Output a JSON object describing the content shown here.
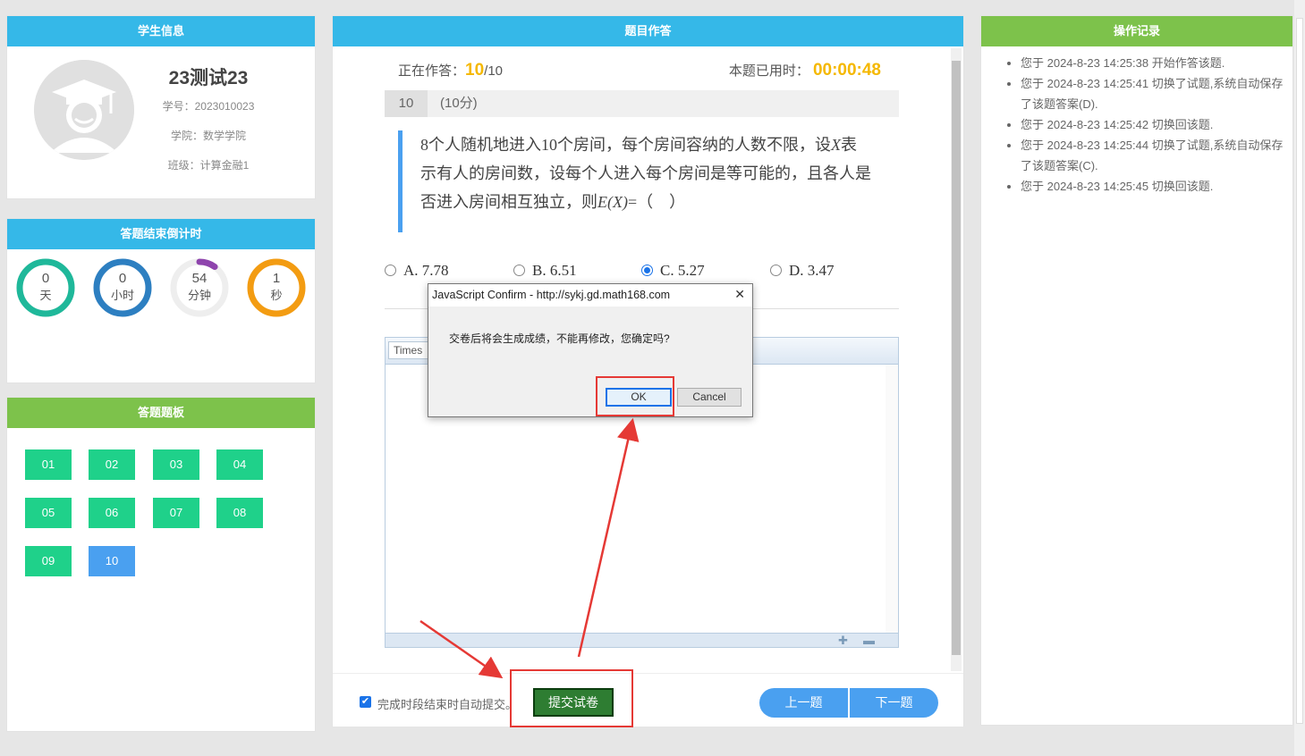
{
  "student": {
    "header": "学生信息",
    "name": "23测试23",
    "id_line": "学号：2023010023",
    "college_line": "学院：数学学院",
    "class_line": "班级：计算金融1"
  },
  "countdown": {
    "header": "答题结束倒计时",
    "items": [
      {
        "value": "0",
        "unit": "天",
        "color": "#1fb89a",
        "fraction": 1.0
      },
      {
        "value": "0",
        "unit": "小时",
        "color": "#2d7fc1",
        "fraction": 1.0
      },
      {
        "value": "54",
        "unit": "分钟",
        "color": "#8e44ad",
        "fraction": 0.1
      },
      {
        "value": "1",
        "unit": "秒",
        "color": "#f39c12",
        "fraction": 1.0
      }
    ]
  },
  "board": {
    "header": "答题题板",
    "questions": [
      "01",
      "02",
      "03",
      "04",
      "05",
      "06",
      "07",
      "08",
      "09",
      "10"
    ],
    "current": "10"
  },
  "main": {
    "header": "题目作答",
    "status_label": "正在作答：",
    "current": "10",
    "total": "/10",
    "timer_label": "本题已用时：",
    "timer": "00:00:48",
    "q_num": "10",
    "q_points": "(10分)",
    "question_html_parts": [
      "8个人随机地进入10个房间，每个房间容纳的人数不限，设",
      "X",
      "表示有人的房间数，设每个人进入每个房间是等可能的，且各人是否进入房间相互独立，则",
      "E(X)",
      "=（　）"
    ],
    "options": [
      {
        "label": "A. 7.78",
        "selected": false
      },
      {
        "label": "B. 6.51",
        "selected": false
      },
      {
        "label": "C. 5.27",
        "selected": true
      },
      {
        "label": "D. 3.47",
        "selected": false
      }
    ],
    "editor_font": "Times",
    "auto_submit_label": "完成时段结束时自动提交。",
    "submit_label": "提交试卷",
    "prev_label": "上一题",
    "next_label": "下一题"
  },
  "log": {
    "header": "操作记录",
    "entries": [
      "您于 2024-8-23  14:25:38 开始作答该题.",
      "您于 2024-8-23  14:25:41 切换了试题,系统自动保存了该题答案(D).",
      "您于 2024-8-23  14:25:42 切换回该题.",
      "您于 2024-8-23  14:25:44 切换了试题,系统自动保存了该题答案(C).",
      "您于 2024-8-23  14:25:45 切换回该题."
    ]
  },
  "dialog": {
    "title": "JavaScript Confirm - http://sykj.gd.math168.com",
    "message": "交卷后将会生成成绩，不能再修改，您确定吗?",
    "ok": "OK",
    "cancel": "Cancel"
  },
  "colors": {
    "blue_header": "#35b8e8",
    "green_header": "#7dc24b",
    "accent_yellow": "#f5b800",
    "answered": "#1fd18a",
    "current_q": "#4aa0f0",
    "annotation_red": "#e53935"
  }
}
